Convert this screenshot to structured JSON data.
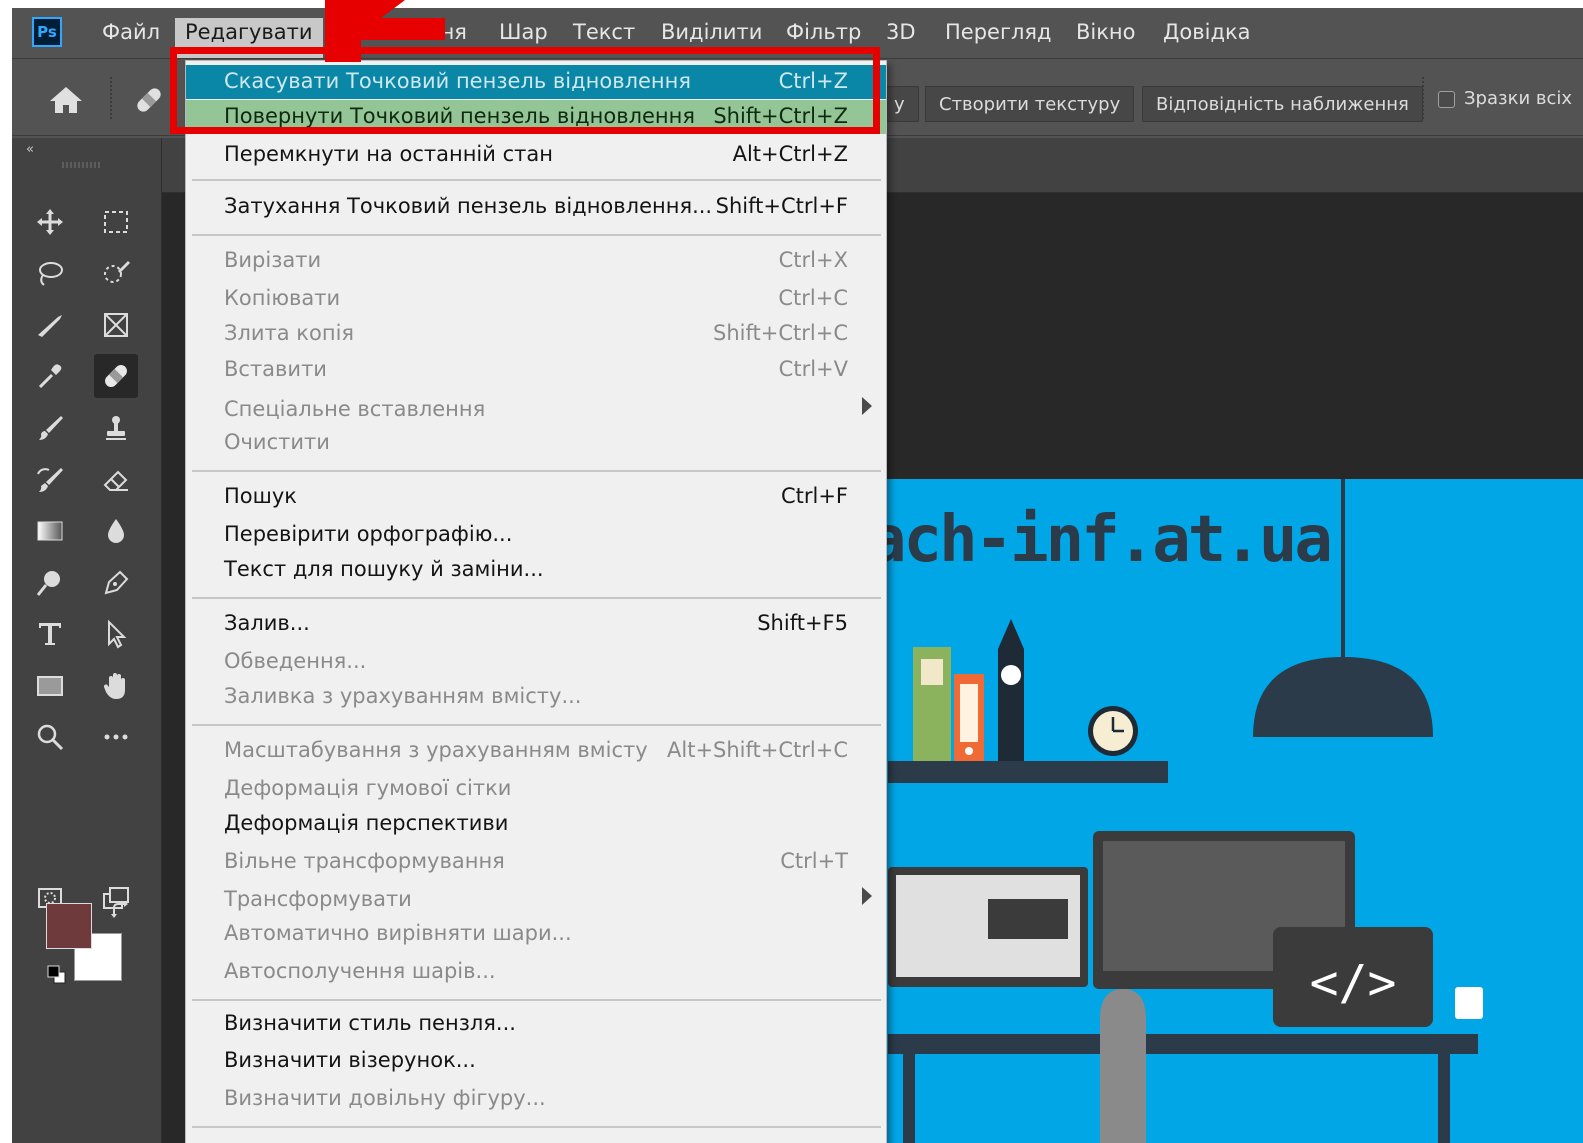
{
  "app": {
    "logo": "Ps"
  },
  "menubar": {
    "items": [
      "Файл",
      "Редагувати",
      "ження",
      "Шар",
      "Текст",
      "Виділити",
      "Фільтр",
      "3D",
      "Перегляд",
      "Вікно",
      "Довідка"
    ]
  },
  "options_bar": {
    "partial_button": "y",
    "create_texture": "Створити текстуру",
    "proximity_match": "Відповідність наближення",
    "sample_all_label": "Зразки всіх",
    "sample_all_checked": false
  },
  "toolbar": {
    "collapse_glyph": "«",
    "foreground_color": "#6e3a3b",
    "background_color": "#ffffff",
    "tools": [
      "move-icon",
      "marquee-icon",
      "lasso-icon",
      "quick-select-icon",
      "crop-icon",
      "frame-icon",
      "eyedropper-icon",
      "spot-healing-icon",
      "brush-icon",
      "stamp-icon",
      "history-brush-icon",
      "eraser-icon",
      "gradient-icon",
      "blur-icon",
      "dodge-icon",
      "pen-icon",
      "type-icon",
      "path-select-icon",
      "rectangle-icon",
      "hand-icon",
      "zoom-icon",
      "more-icon",
      "quick-mask-icon",
      "screen-mode-icon"
    ]
  },
  "edit_menu": {
    "items": [
      {
        "label": "Скасувати Точковий пензель відновлення",
        "shortcut": "Ctrl+Z",
        "state": "highlight-undo"
      },
      {
        "label": "Повернути Точковий пензель відновлення",
        "shortcut": "Shift+Ctrl+Z",
        "state": "highlight-redo"
      },
      {
        "label": "Перемкнути на останній стан",
        "shortcut": "Alt+Ctrl+Z",
        "state": "enabled"
      },
      {
        "label": "Затухання Точковий пензель відновлення...",
        "shortcut": "Shift+Ctrl+F",
        "state": "enabled"
      },
      {
        "label": "Вирізати",
        "shortcut": "Ctrl+X",
        "state": "disabled"
      },
      {
        "label": "Копіювати",
        "shortcut": "Ctrl+C",
        "state": "disabled"
      },
      {
        "label": "Злита копія",
        "shortcut": "Shift+Ctrl+C",
        "state": "disabled"
      },
      {
        "label": "Вставити",
        "shortcut": "Ctrl+V",
        "state": "disabled"
      },
      {
        "label": "Спеціальне вставлення",
        "shortcut": "",
        "state": "disabled",
        "submenu": true
      },
      {
        "label": "Очистити",
        "shortcut": "",
        "state": "disabled"
      },
      {
        "label": "Пошук",
        "shortcut": "Ctrl+F",
        "state": "enabled"
      },
      {
        "label": "Перевірити орфографію...",
        "shortcut": "",
        "state": "enabled"
      },
      {
        "label": "Текст для пошуку й заміни...",
        "shortcut": "",
        "state": "enabled"
      },
      {
        "label": "Залив...",
        "shortcut": "Shift+F5",
        "state": "enabled"
      },
      {
        "label": "Обведення...",
        "shortcut": "",
        "state": "disabled"
      },
      {
        "label": "Заливка з урахуванням вмісту...",
        "shortcut": "",
        "state": "disabled"
      },
      {
        "label": "Масштабування з урахуванням вмісту",
        "shortcut": "Alt+Shift+Ctrl+C",
        "state": "disabled"
      },
      {
        "label": "Деформація гумової сітки",
        "shortcut": "",
        "state": "disabled"
      },
      {
        "label": "Деформація перспективи",
        "shortcut": "",
        "state": "enabled"
      },
      {
        "label": "Вільне трансформування",
        "shortcut": "Ctrl+T",
        "state": "disabled"
      },
      {
        "label": "Трансформувати",
        "shortcut": "",
        "state": "disabled",
        "submenu": true
      },
      {
        "label": "Автоматично вирівняти шари...",
        "shortcut": "",
        "state": "disabled"
      },
      {
        "label": "Автосполучення шарів...",
        "shortcut": "",
        "state": "disabled"
      },
      {
        "label": "Визначити стиль пензля...",
        "shortcut": "",
        "state": "enabled"
      },
      {
        "label": "Визначити візерунок...",
        "shortcut": "",
        "state": "enabled"
      },
      {
        "label": "Визначити довільну фігуру...",
        "shortcut": "",
        "state": "disabled"
      }
    ]
  },
  "document": {
    "visible_text": "ach-inf.at.ua",
    "background_color": "#00a6e6"
  },
  "annotation": {
    "highlight_color": "#e60000"
  }
}
